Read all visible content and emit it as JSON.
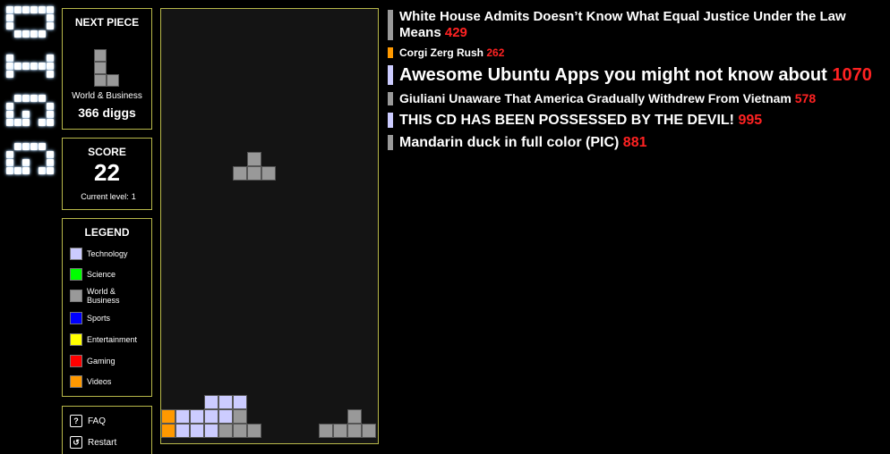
{
  "colors": {
    "technology": "#ccccff",
    "science": "#00ff00",
    "world_business": "#999999",
    "sports": "#0000ff",
    "entertainment": "#ffff00",
    "gaming": "#ff0000",
    "videos": "#ff9900",
    "count": "#ff2222",
    "frame": "#b8b84a"
  },
  "logo": {
    "letters": "DIGG"
  },
  "next_piece": {
    "title": "NEXT PIECE",
    "shape": "L",
    "category": "World & Business",
    "diggs": "366 diggs"
  },
  "score": {
    "title": "SCORE",
    "value": "22",
    "level_label": "Current level:",
    "level": "1"
  },
  "legend": {
    "title": "LEGEND",
    "items": [
      {
        "label": "Technology",
        "color": "technology"
      },
      {
        "label": "Science",
        "color": "science"
      },
      {
        "label": "World & Business",
        "color": "world_business"
      },
      {
        "label": "Sports",
        "color": "sports"
      },
      {
        "label": "Entertainment",
        "color": "entertainment"
      },
      {
        "label": "Gaming",
        "color": "gaming"
      },
      {
        "label": "Videos",
        "color": "videos"
      }
    ]
  },
  "help": {
    "faq_label": "FAQ",
    "faq_icon": "question-icon",
    "restart_label": "Restart",
    "restart_icon": "restart-icon"
  },
  "board": {
    "cols": 15,
    "rows": 30,
    "falling_piece": {
      "shape": "T",
      "color": "world_business"
    },
    "stack_rows": [
      "...TTT.........",
      "VTTTTW.......W.",
      "VTTTWWW....WWWW"
    ]
  },
  "news": [
    {
      "title": "White House Admits Doesn’t Know What Equal Justice Under the Law Means",
      "count": "429",
      "category": "world_business",
      "size": 15
    },
    {
      "title": "Corgi Zerg Rush",
      "count": "262",
      "category": "videos",
      "size": 12
    },
    {
      "title": "Awesome Ubuntu Apps you might not know about",
      "count": "1070",
      "category": "technology",
      "size": 20
    },
    {
      "title": "Giuliani Unaware That America Gradually Withdrew From Vietnam",
      "count": "578",
      "category": "world_business",
      "size": 14
    },
    {
      "title": "THIS CD HAS BEEN POSSESSED BY THE DEVIL!",
      "count": "995",
      "category": "technology",
      "size": 16
    },
    {
      "title": "Mandarin duck in full color (PIC)",
      "count": "881",
      "category": "world_business",
      "size": 16
    }
  ]
}
